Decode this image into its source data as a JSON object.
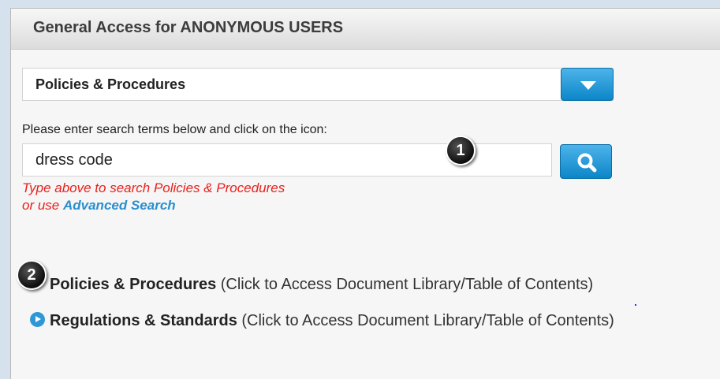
{
  "panel": {
    "title": "General Access for ANONYMOUS USERS"
  },
  "library_select": {
    "selected": "Policies & Procedures",
    "button_icon": "chevron-down-icon"
  },
  "search": {
    "instructions": "Please enter search terms below and click on the icon:",
    "value": "dress code",
    "button_icon": "search-icon",
    "hint_line1": "Type above to search Policies & Procedures",
    "hint_prefix": "or use ",
    "advanced_link": "Advanced Search"
  },
  "callouts": {
    "badge1": "1",
    "badge2": "2"
  },
  "links": [
    {
      "title": "Policies & Procedures",
      "desc": " (Click to Access Document Library/Table of Contents)",
      "icon": "play-circle-icon"
    },
    {
      "title": "Regulations & Standards",
      "desc": " (Click to Access Document Library/Table of Contents)",
      "icon": "play-circle-icon"
    }
  ],
  "colors": {
    "accent_blue": "#1a97dd",
    "hint_red": "#e8201c",
    "link_blue": "#2a8fcf"
  }
}
